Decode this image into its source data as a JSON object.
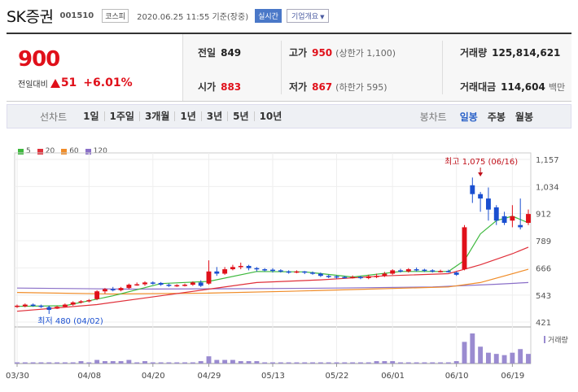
{
  "header": {
    "name": "SK증권",
    "code": "001510",
    "market": "코스피",
    "datetime": "2020.06.25 11:55  기준(장중)",
    "realtime": "실시간",
    "overview": "기업개요"
  },
  "price": {
    "current": "900",
    "change_label": "전일대비",
    "change": "51",
    "change_pct": "+6.01%"
  },
  "stats": {
    "prev_close_label": "전일",
    "prev_close": "849",
    "high_label": "고가",
    "high": "950",
    "upper_limit": "(상한가 1,100)",
    "volume_label": "거래량",
    "volume": "125,814,621",
    "open_label": "시가",
    "open": "883",
    "low_label": "저가",
    "low": "867",
    "lower_limit": "(하한가 595)",
    "amount_label": "거래대금",
    "amount": "114,604",
    "amount_unit": "백만"
  },
  "periods": {
    "label": "선차트",
    "items": [
      "1일",
      "1주일",
      "3개월",
      "1년",
      "3년",
      "5년",
      "10년"
    ],
    "candle_label": "봉차트",
    "candle_items": [
      "일봉",
      "주봉",
      "월봉"
    ],
    "active_candle": "일봉"
  },
  "legend": [
    {
      "name": "5",
      "color": "#3cb83c"
    },
    {
      "name": "20",
      "color": "#e0303a"
    },
    {
      "name": "60",
      "color": "#f08c28"
    },
    {
      "name": "120",
      "color": "#8a6fc8"
    }
  ],
  "colors": {
    "up": "#e0101a",
    "down": "#1a4fd0"
  },
  "chart_data": {
    "type": "candlestick",
    "y_ticks": [
      "1,157",
      "1,034",
      "912",
      "789",
      "666",
      "543",
      "421"
    ],
    "y_values": [
      1157,
      1034,
      912,
      789,
      666,
      543,
      421
    ],
    "x_ticks": [
      "03/30",
      "04/08",
      "04/20",
      "04/29",
      "05/13",
      "05/22",
      "06/01",
      "06/10",
      "06/19"
    ],
    "x_tick_index": [
      0,
      9,
      17,
      24,
      32,
      40,
      47,
      55,
      62
    ],
    "high_annotation": "최고 1,075 (06/16)",
    "low_annotation": "최저 480 (04/02)",
    "high_annotation_index": 58,
    "low_annotation_index": 4,
    "volume_label": "거래량",
    "candles": [
      [
        490,
        495,
        485,
        500
      ],
      [
        492,
        500,
        488,
        505
      ],
      [
        500,
        495,
        490,
        505
      ],
      [
        495,
        490,
        485,
        500
      ],
      [
        488,
        482,
        480,
        495
      ],
      [
        482,
        490,
        480,
        495
      ],
      [
        490,
        500,
        488,
        505
      ],
      [
        500,
        510,
        495,
        515
      ],
      [
        510,
        515,
        505,
        520
      ],
      [
        515,
        520,
        510,
        525
      ],
      [
        525,
        560,
        520,
        565
      ],
      [
        560,
        570,
        550,
        575
      ],
      [
        570,
        565,
        560,
        580
      ],
      [
        565,
        575,
        560,
        580
      ],
      [
        575,
        590,
        570,
        595
      ],
      [
        590,
        592,
        585,
        600
      ],
      [
        592,
        600,
        585,
        605
      ],
      [
        600,
        598,
        590,
        605
      ],
      [
        598,
        590,
        585,
        602
      ],
      [
        590,
        585,
        580,
        595
      ],
      [
        585,
        588,
        580,
        592
      ],
      [
        588,
        590,
        582,
        595
      ],
      [
        590,
        600,
        585,
        605
      ],
      [
        600,
        585,
        580,
        610
      ],
      [
        595,
        650,
        590,
        700
      ],
      [
        650,
        640,
        630,
        670
      ],
      [
        640,
        660,
        635,
        670
      ],
      [
        660,
        670,
        655,
        680
      ],
      [
        670,
        675,
        660,
        690
      ],
      [
        675,
        665,
        655,
        680
      ],
      [
        665,
        660,
        650,
        670
      ],
      [
        660,
        658,
        650,
        665
      ],
      [
        658,
        655,
        645,
        665
      ],
      [
        655,
        650,
        645,
        660
      ],
      [
        650,
        648,
        640,
        655
      ],
      [
        648,
        650,
        642,
        655
      ],
      [
        650,
        645,
        638,
        652
      ],
      [
        645,
        640,
        635,
        650
      ],
      [
        640,
        630,
        625,
        645
      ],
      [
        630,
        628,
        620,
        635
      ],
      [
        628,
        625,
        618,
        632
      ],
      [
        625,
        622,
        618,
        630
      ],
      [
        622,
        625,
        618,
        632
      ],
      [
        625,
        620,
        615,
        630
      ],
      [
        620,
        628,
        615,
        635
      ],
      [
        628,
        630,
        620,
        640
      ],
      [
        630,
        640,
        625,
        648
      ],
      [
        640,
        655,
        635,
        660
      ],
      [
        655,
        650,
        645,
        662
      ],
      [
        650,
        660,
        645,
        665
      ],
      [
        660,
        658,
        650,
        668
      ],
      [
        658,
        655,
        648,
        662
      ],
      [
        655,
        650,
        645,
        660
      ],
      [
        650,
        652,
        645,
        658
      ],
      [
        652,
        650,
        645,
        658
      ],
      [
        645,
        635,
        630,
        650
      ],
      [
        660,
        850,
        655,
        860
      ],
      [
        1040,
        1000,
        960,
        1075
      ],
      [
        1000,
        980,
        920,
        1010
      ],
      [
        980,
        930,
        880,
        1030
      ],
      [
        940,
        880,
        860,
        950
      ],
      [
        900,
        870,
        860,
        920
      ],
      [
        880,
        900,
        850,
        950
      ],
      [
        860,
        850,
        840,
        980
      ],
      [
        870,
        910,
        860,
        930
      ]
    ],
    "ma": {
      "5": [
        [
          0,
          492
        ],
        [
          6,
          495
        ],
        [
          12,
          540
        ],
        [
          18,
          595
        ],
        [
          24,
          605
        ],
        [
          30,
          650
        ],
        [
          36,
          648
        ],
        [
          42,
          625
        ],
        [
          48,
          650
        ],
        [
          54,
          650
        ],
        [
          56,
          700
        ],
        [
          58,
          820
        ],
        [
          60,
          880
        ],
        [
          62,
          900
        ],
        [
          64,
          870
        ]
      ],
      "20": [
        [
          0,
          470
        ],
        [
          10,
          500
        ],
        [
          18,
          540
        ],
        [
          24,
          570
        ],
        [
          30,
          600
        ],
        [
          38,
          612
        ],
        [
          46,
          630
        ],
        [
          54,
          640
        ],
        [
          58,
          680
        ],
        [
          62,
          730
        ],
        [
          64,
          760
        ]
      ],
      "60": [
        [
          0,
          555
        ],
        [
          12,
          548
        ],
        [
          24,
          552
        ],
        [
          34,
          560
        ],
        [
          44,
          570
        ],
        [
          54,
          580
        ],
        [
          58,
          600
        ],
        [
          64,
          660
        ]
      ],
      "120": [
        [
          0,
          575
        ],
        [
          14,
          570
        ],
        [
          28,
          572
        ],
        [
          40,
          575
        ],
        [
          52,
          580
        ],
        [
          60,
          592
        ],
        [
          64,
          600
        ]
      ]
    },
    "volume": [
      1,
      1,
      1,
      1,
      1,
      1,
      1,
      1,
      2,
      1,
      3,
      2,
      2,
      2,
      3,
      1,
      2,
      1,
      1,
      1,
      1,
      1,
      1,
      2,
      6,
      3,
      3,
      3,
      2,
      2,
      2,
      1,
      1,
      1,
      1,
      1,
      1,
      1,
      1,
      1,
      1,
      1,
      1,
      1,
      1,
      2,
      2,
      2,
      1,
      1,
      1,
      1,
      1,
      1,
      1,
      2,
      18,
      25,
      14,
      9,
      8,
      7,
      9,
      12,
      8
    ],
    "ylim": [
      421,
      1157
    ]
  }
}
